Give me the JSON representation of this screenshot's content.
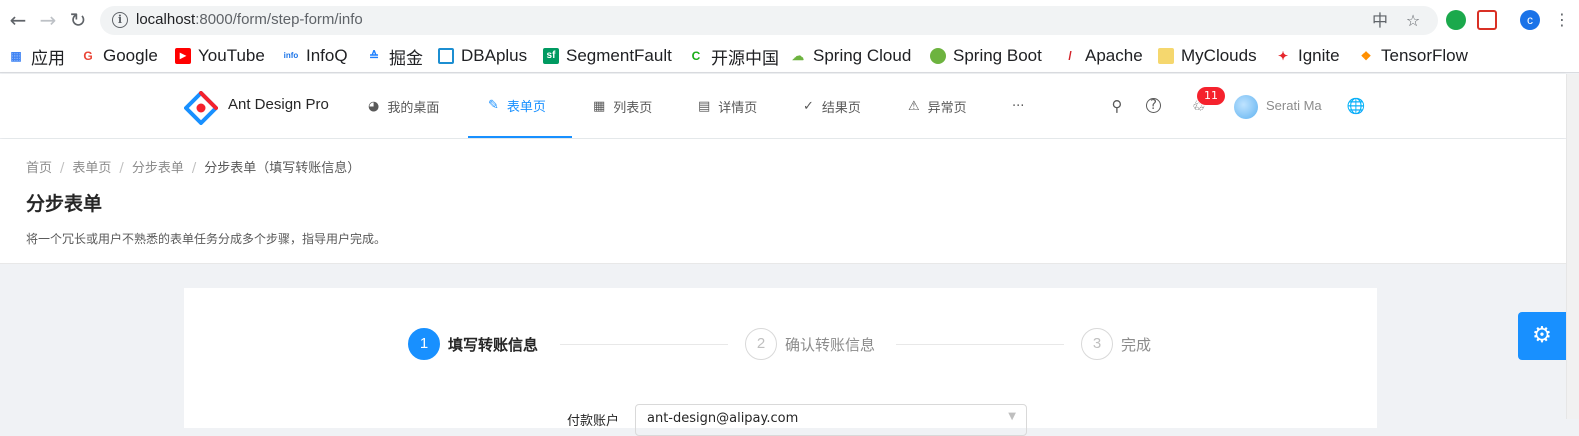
{
  "browser": {
    "url_host": "localhost",
    "url_rest": ":8000/form/step-form/info"
  },
  "bookmarks": [
    {
      "label": "应用",
      "icon": "apps-grid-icon",
      "color": "#4285f4"
    },
    {
      "label": "Google",
      "icon": "google-g-icon",
      "color": "#ea4335"
    },
    {
      "label": "YouTube",
      "icon": "youtube-icon",
      "color": "#ff0000"
    },
    {
      "label": "InfoQ",
      "icon": "infoq-icon",
      "color": "#1a73e8"
    },
    {
      "label": "掘金",
      "icon": "juejin-icon",
      "color": "#1e80ff"
    },
    {
      "label": "DBAplus",
      "icon": "dbaplus-icon",
      "color": "#1c8ed1"
    },
    {
      "label": "SegmentFault",
      "icon": "sf-icon",
      "color": "#009a61"
    },
    {
      "label": "开源中国",
      "icon": "oschina-icon",
      "color": "#1aad19"
    },
    {
      "label": "Spring Cloud",
      "icon": "spring-cloud-icon",
      "color": "#6db33f"
    },
    {
      "label": "Spring Boot",
      "icon": "spring-boot-icon",
      "color": "#6db33f"
    },
    {
      "label": "Apache",
      "icon": "apache-feather-icon",
      "color": "#d22128"
    },
    {
      "label": "MyClouds",
      "icon": "folder-icon",
      "color": "#f5d76e"
    },
    {
      "label": "Ignite",
      "icon": "ignite-icon",
      "color": "#e6262c"
    },
    {
      "label": "TensorFlow",
      "icon": "tensorflow-icon",
      "color": "#ff8f00"
    }
  ],
  "app": {
    "title": "Ant Design Pro",
    "menu": [
      {
        "label": "我的桌面",
        "icon": "dashboard-icon",
        "active": false
      },
      {
        "label": "表单页",
        "icon": "form-edit-icon",
        "active": true
      },
      {
        "label": "列表页",
        "icon": "table-icon",
        "active": false
      },
      {
        "label": "详情页",
        "icon": "profile-icon",
        "active": false
      },
      {
        "label": "结果页",
        "icon": "check-circle-icon",
        "active": false
      },
      {
        "label": "异常页",
        "icon": "warning-icon",
        "active": false
      }
    ],
    "more": "···",
    "notice_count": "11",
    "user_name": "Serati Ma",
    "accent": "#1890ff"
  },
  "page": {
    "breadcrumb": [
      "首页",
      "表单页",
      "分步表单",
      "分步表单（填写转账信息）"
    ],
    "title": "分步表单",
    "description": "将一个冗长或用户不熟悉的表单任务分成多个步骤，指导用户完成。"
  },
  "steps": [
    {
      "num": "1",
      "label": "填写转账信息",
      "status": "process"
    },
    {
      "num": "2",
      "label": "确认转账信息",
      "status": "wait"
    },
    {
      "num": "3",
      "label": "完成",
      "status": "wait"
    }
  ],
  "form": {
    "pay_account_label": "付款账户",
    "pay_account_value": "ant-design@alipay.com"
  }
}
